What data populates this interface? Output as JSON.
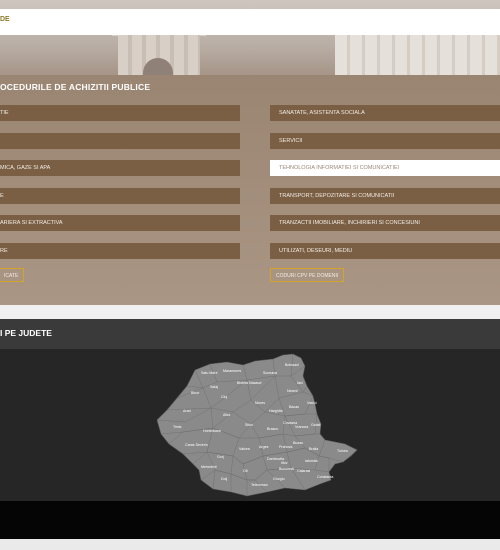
{
  "header": {
    "logo_fragment": "DE"
  },
  "procedures": {
    "title": "OCEDURILE DE ACHIZITII PUBLICE",
    "left_items": [
      "TIE",
      "",
      "MICA, GAZE SI APA",
      "E",
      "ARIERA SI EXTRACTIVA",
      "RE"
    ],
    "right_items": [
      "SANATATE, ASISTENTA SOCIALA",
      "SERVICII",
      "TEHNOLOGIA INFORMATIEI SI COMUNICATIEI",
      "TRANSPORT, DEPOZITARE SI COMUNICATII",
      "TRANZACTII IMOBILIARE, INCHIRIERI SI CONCESIUNI",
      "UTILIZATI, DESEURI, MEDIU"
    ],
    "active_right_index": 2,
    "left_button": "ICATE",
    "right_button": "CODURI CPV PE DOMENII"
  },
  "counties": {
    "title": "I PE JUDETE",
    "map_labels": [
      "Satu Mare",
      "Maramures",
      "Suceava",
      "Botosani",
      "Salaj",
      "Bistrita Nasaud",
      "Iasi",
      "Bihor",
      "Cluj",
      "Neamt",
      "Mures",
      "Harghita",
      "Bacau",
      "Vaslui",
      "Arad",
      "Alba",
      "Sibiu",
      "Covasna",
      "Vrancea",
      "Galati",
      "Timis",
      "Hunedoara",
      "Brasov",
      "Buzau",
      "Braila",
      "Tulcea",
      "Caras Severin",
      "Valcea",
      "Arges",
      "Prahova",
      "Ialomita",
      "Constanta",
      "Mehedinti",
      "Gorj",
      "Olt",
      "Dambovita",
      "Calarasi",
      "Dolj",
      "Teleorman",
      "Giurgiu",
      "Ilfov",
      "Bucuresti"
    ]
  }
}
